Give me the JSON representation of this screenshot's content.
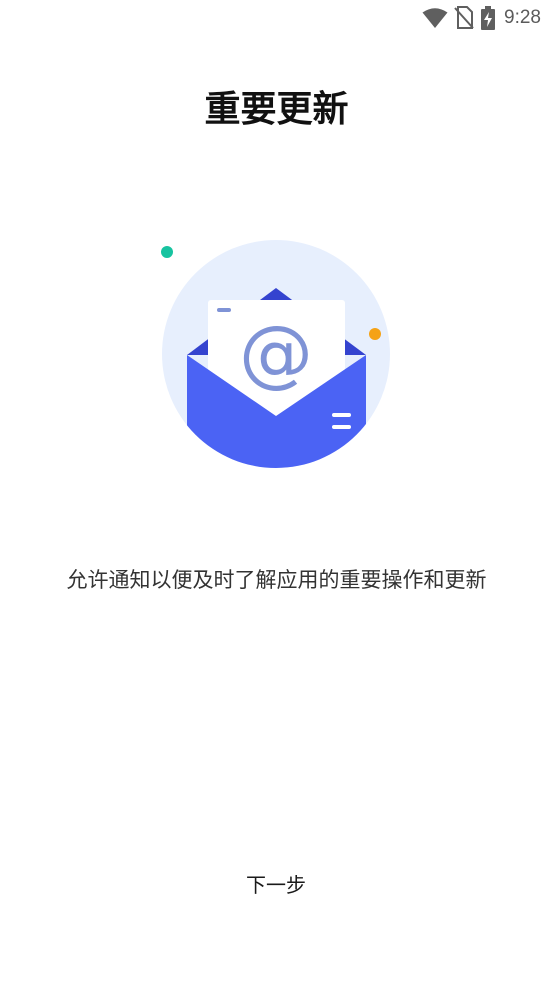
{
  "status_bar": {
    "time": "9:28",
    "icons": [
      "wifi-icon",
      "no-sim-icon",
      "battery-charging-icon"
    ]
  },
  "title": "重要更新",
  "illustration": {
    "icon": "email-envelope-icon",
    "symbol": "@",
    "colors": {
      "circle": "#e7effd",
      "envelope": "#4b63f4",
      "envelope_dark": "#3443cf",
      "letter": "#ffffff",
      "at_sign": "#7f93d6",
      "dot_teal": "#17c3a0",
      "dot_orange": "#f5a216"
    }
  },
  "description": "允许通知以便及时了解应用的重要操作和更新",
  "next_button": {
    "label": "下一步"
  }
}
